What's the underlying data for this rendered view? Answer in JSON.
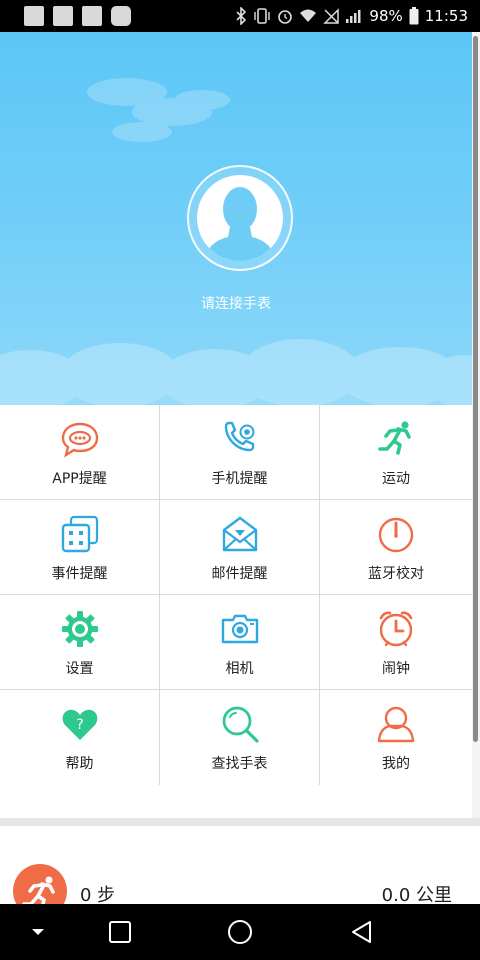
{
  "status_bar": {
    "battery": "98%",
    "time": "11:53"
  },
  "header": {
    "connect_text": "请连接手表"
  },
  "grid": {
    "items": [
      {
        "label": "APP提醒",
        "icon": "chat-bubble-icon",
        "color": "#f06c47"
      },
      {
        "label": "手机提醒",
        "icon": "phone-call-icon",
        "color": "#2fa8e0"
      },
      {
        "label": "运动",
        "icon": "running-man-icon",
        "color": "#2ec98e"
      },
      {
        "label": "事件提醒",
        "icon": "event-dice-icon",
        "color": "#2fa8e0"
      },
      {
        "label": "邮件提醒",
        "icon": "mail-heart-icon",
        "color": "#2fa8e0"
      },
      {
        "label": "蓝牙校对",
        "icon": "timer-icon",
        "color": "#f06c47"
      },
      {
        "label": "设置",
        "icon": "gear-icon",
        "color": "#2ec98e"
      },
      {
        "label": "相机",
        "icon": "camera-icon",
        "color": "#2fa8e0"
      },
      {
        "label": "闹钟",
        "icon": "alarm-clock-icon",
        "color": "#f06c47"
      },
      {
        "label": "帮助",
        "icon": "heart-question-icon",
        "color": "#2ec98e"
      },
      {
        "label": "查找手表",
        "icon": "search-icon",
        "color": "#2ec98e"
      },
      {
        "label": "我的",
        "icon": "person-icon",
        "color": "#f06c47"
      }
    ]
  },
  "stats": {
    "steps": "0 步",
    "distance": "0.0 公里",
    "badge_color": "#f06c47"
  },
  "nav_bar": {
    "buttons": [
      "dropdown-icon",
      "recents-icon",
      "home-icon",
      "back-icon"
    ]
  }
}
